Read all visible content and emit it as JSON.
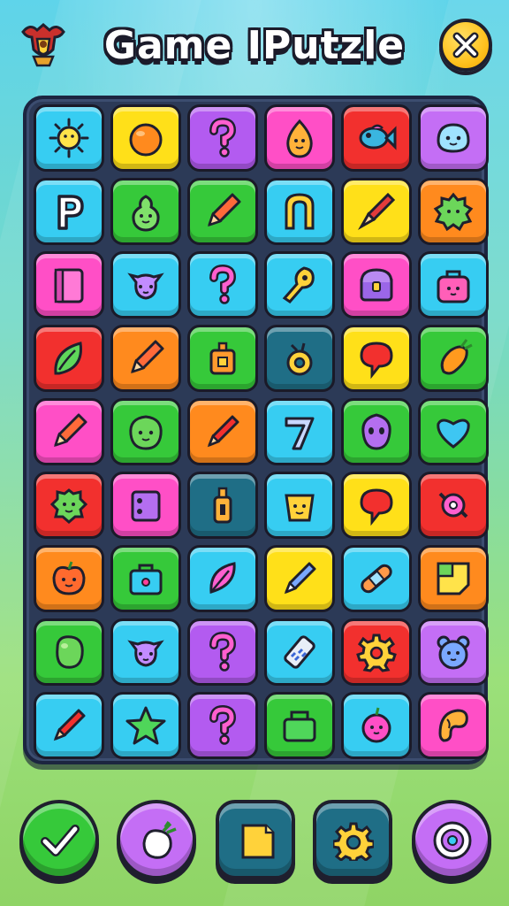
{
  "header": {
    "title": "Game IPutzle",
    "emblem_icon": "eagle-crest-icon",
    "close_icon": "close-icon"
  },
  "colors": {
    "cyan": "#37cdf2",
    "yellow": "#ffe019",
    "purple": "#b35bf0",
    "pink": "#ff4fc6",
    "red": "#f2302e",
    "green": "#36c93a",
    "orange": "#ff8a1e",
    "teal": "#1f6e86",
    "violet": "#c46ef5"
  },
  "board": {
    "rows": [
      [
        {
          "color": "cyan",
          "icon": "sun-icon"
        },
        {
          "color": "yellow",
          "icon": "orange-fruit-icon"
        },
        {
          "color": "purple",
          "icon": "question-mark-icon"
        },
        {
          "color": "pink",
          "icon": "egg-icon"
        },
        {
          "color": "red",
          "icon": "fish-icon"
        },
        {
          "color": "violet",
          "icon": "ghost-face-icon"
        }
      ],
      [
        {
          "color": "cyan",
          "icon": "letter-p-icon"
        },
        {
          "color": "green",
          "icon": "pear-face-icon"
        },
        {
          "color": "green",
          "icon": "pencil-icon"
        },
        {
          "color": "cyan",
          "icon": "arch-icon"
        },
        {
          "color": "yellow",
          "icon": "brush-icon"
        },
        {
          "color": "orange",
          "icon": "gear-blob-icon"
        }
      ],
      [
        {
          "color": "pink",
          "icon": "door-box-icon"
        },
        {
          "color": "cyan",
          "icon": "cat-face-icon"
        },
        {
          "color": "cyan",
          "icon": "question-mark-icon"
        },
        {
          "color": "cyan",
          "icon": "key-icon"
        },
        {
          "color": "pink",
          "icon": "treasure-box-icon"
        },
        {
          "color": "cyan",
          "icon": "bag-face-icon"
        }
      ],
      [
        {
          "color": "red",
          "icon": "leaf-icon"
        },
        {
          "color": "orange",
          "icon": "pencil-icon"
        },
        {
          "color": "green",
          "icon": "lantern-box-icon"
        },
        {
          "color": "teal",
          "icon": "ring-icon"
        },
        {
          "color": "yellow",
          "icon": "speech-bubble-icon"
        },
        {
          "color": "green",
          "icon": "carrot-icon"
        }
      ],
      [
        {
          "color": "pink",
          "icon": "pencil-icon"
        },
        {
          "color": "green",
          "icon": "blob-face-icon"
        },
        {
          "color": "orange",
          "icon": "crayon-icon"
        },
        {
          "color": "cyan",
          "icon": "number-seven-icon"
        },
        {
          "color": "green",
          "icon": "alien-face-icon"
        },
        {
          "color": "green",
          "icon": "heart-icon"
        }
      ],
      [
        {
          "color": "red",
          "icon": "monster-face-icon"
        },
        {
          "color": "pink",
          "icon": "speaker-box-icon"
        },
        {
          "color": "teal",
          "icon": "bottle-icon"
        },
        {
          "color": "cyan",
          "icon": "bucket-face-icon"
        },
        {
          "color": "yellow",
          "icon": "speech-bubble-icon"
        },
        {
          "color": "red",
          "icon": "candy-icon"
        }
      ],
      [
        {
          "color": "orange",
          "icon": "apple-face-icon"
        },
        {
          "color": "green",
          "icon": "lunchbox-icon"
        },
        {
          "color": "cyan",
          "icon": "feather-icon"
        },
        {
          "color": "yellow",
          "icon": "pen-icon"
        },
        {
          "color": "cyan",
          "icon": "bandage-icon"
        },
        {
          "color": "orange",
          "icon": "sticky-note-icon"
        }
      ],
      [
        {
          "color": "green",
          "icon": "jelly-bean-icon"
        },
        {
          "color": "cyan",
          "icon": "cat-face-icon"
        },
        {
          "color": "purple",
          "icon": "question-mark-icon"
        },
        {
          "color": "cyan",
          "icon": "battery-icon"
        },
        {
          "color": "red",
          "icon": "cog-icon"
        },
        {
          "color": "violet",
          "icon": "bear-face-icon"
        }
      ],
      [
        {
          "color": "cyan",
          "icon": "crayon-icon"
        },
        {
          "color": "cyan",
          "icon": "star-icon"
        },
        {
          "color": "purple",
          "icon": "question-mark-icon"
        },
        {
          "color": "green",
          "icon": "basket-icon"
        },
        {
          "color": "cyan",
          "icon": "berry-face-icon"
        },
        {
          "color": "pink",
          "icon": "croissant-icon"
        }
      ]
    ]
  },
  "toolbar": [
    {
      "name": "confirm-button",
      "icon": "check-icon",
      "color": "green"
    },
    {
      "name": "hint-button",
      "icon": "radish-icon",
      "color": "violet"
    },
    {
      "name": "notes-button",
      "icon": "note-icon",
      "color": "teal"
    },
    {
      "name": "settings-button",
      "icon": "gear-icon",
      "color": "teal"
    },
    {
      "name": "power-up-button",
      "icon": "target-icon",
      "color": "violet"
    }
  ]
}
